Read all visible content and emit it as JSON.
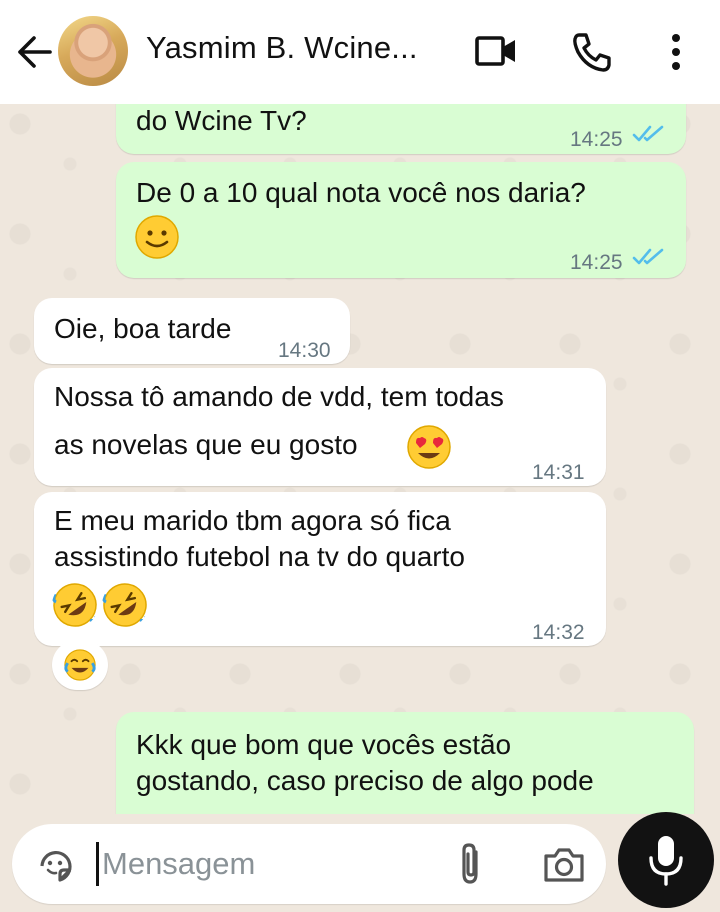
{
  "header": {
    "contact_name": "Yasmim B. Wcine...",
    "icons": [
      "back-arrow-icon",
      "video-call-icon",
      "voice-call-icon",
      "more-options-icon"
    ]
  },
  "messages": [
    {
      "direction": "outgoing",
      "text": "do Wcine Tv?",
      "time": "14:25",
      "status": "read"
    },
    {
      "direction": "outgoing",
      "text": "De 0 a 10 qual nota você nos daria?",
      "emoji": "slightly-smiling-face",
      "time": "14:25",
      "status": "read"
    },
    {
      "direction": "incoming",
      "text": "Oie, boa tarde",
      "time": "14:30"
    },
    {
      "direction": "incoming",
      "lines": [
        "Nossa tô amando de vdd, tem todas",
        "as novelas que eu gosto"
      ],
      "emoji": "heart-eyes-face",
      "time": "14:31"
    },
    {
      "direction": "incoming",
      "lines": [
        "E meu marido tbm agora só fica",
        "assistindo futebol na tv do quarto"
      ],
      "emoji": "rolling-on-floor-laughing x2",
      "time": "14:32"
    },
    {
      "direction": "outgoing",
      "lines": [
        "Kkk que bom que vocês estão",
        "gostando, caso preciso de algo pode"
      ]
    }
  ],
  "reaction": {
    "emoji": "face-with-tears-of-joy"
  },
  "composer": {
    "placeholder": "Mensagem",
    "icons": [
      "sticker-icon",
      "attach-icon",
      "camera-icon",
      "mic-icon"
    ]
  },
  "colors": {
    "outgoing_bubble": "#d9fdd3",
    "incoming_bubble": "#ffffff",
    "chat_background": "#efe7dd",
    "read_ticks": "#53bdeb",
    "mic_button": "#121212"
  }
}
